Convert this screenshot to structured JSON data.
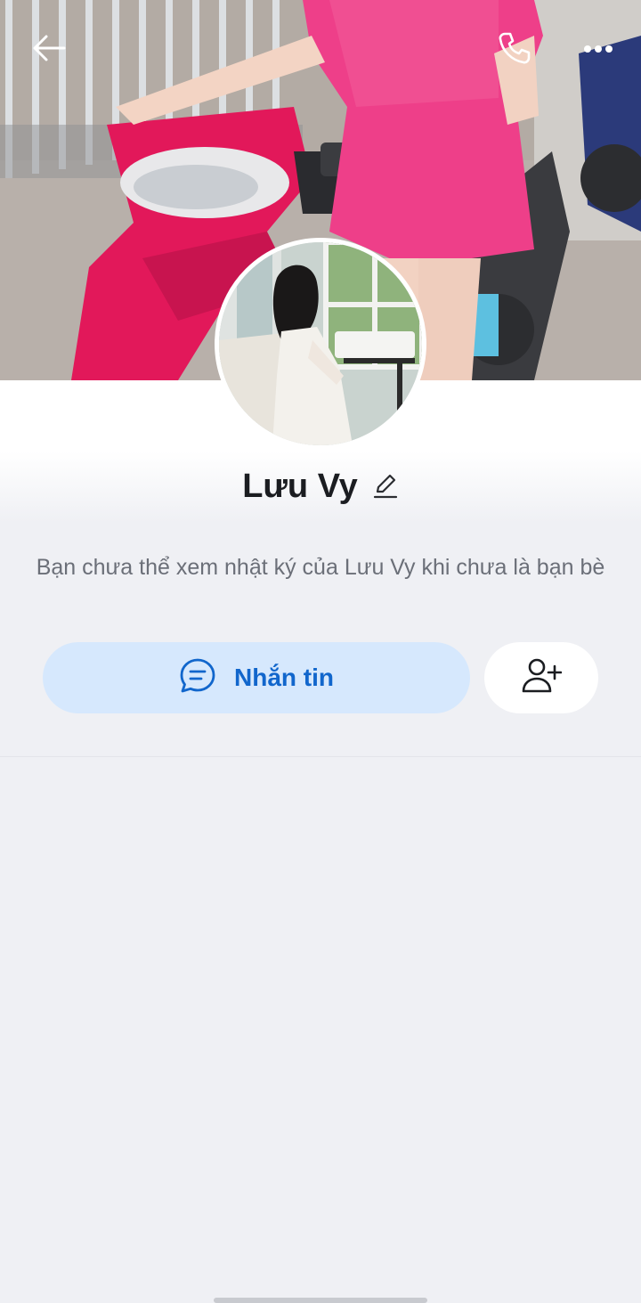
{
  "profile": {
    "name": "Lưu Vy",
    "notice": "Bạn chưa thể xem nhật ký của Lưu Vy khi chưa là bạn bè"
  },
  "actions": {
    "message_label": "Nhắn tin"
  },
  "icons": {
    "back": "arrow-left-icon",
    "call": "phone-icon",
    "more": "more-dots-icon",
    "edit": "pencil-icon",
    "message": "chat-bubble-icon",
    "add_friend": "add-friend-icon"
  },
  "colors": {
    "accent": "#1166cc",
    "message_button_bg": "#d6e8fd",
    "page_bg": "#eff0f4"
  }
}
